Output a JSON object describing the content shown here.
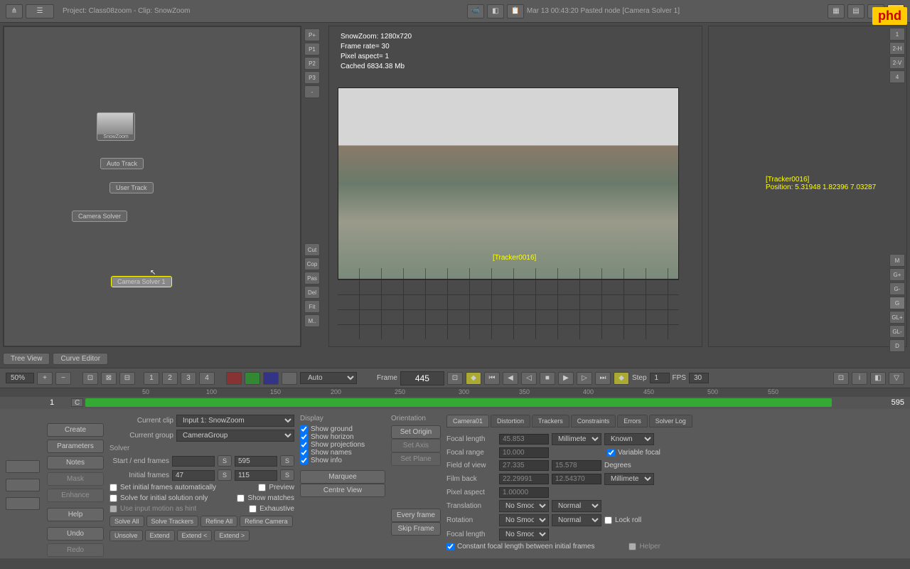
{
  "toolbar": {
    "project_info": "Project: Class08zoom - Clip: SnowZoom",
    "status": "Mar 13 00:43:20 Pasted node [Camera Solver 1]"
  },
  "logo": "phd",
  "nodes": {
    "source": "SnowZoom",
    "autotrack": "Auto Track",
    "usertrack": "User Track",
    "camsolver": "Camera Solver",
    "camsolver1": "Camera Solver 1"
  },
  "side_buttons_left": [
    "P+",
    "P1",
    "P2",
    "P3",
    "-",
    "Cut",
    "Cop",
    "Pas",
    "Del",
    "Fit",
    "M.."
  ],
  "viewport": {
    "info1": "SnowZoom: 1280x720",
    "info2": "Frame rate= 30",
    "info3": "Pixel aspect= 1",
    "info4": "Cached 6834.38 Mb",
    "tracker_label": "[Tracker0016]",
    "tracker_pos": "Position: 5.31948 1.82396 7.03287"
  },
  "right_buttons": [
    "1",
    "2-H",
    "2-V",
    "4",
    "M",
    "G+",
    "G-",
    "G",
    "GL+",
    "GL-",
    "D"
  ],
  "tabs": {
    "tree": "Tree View",
    "curve": "Curve Editor"
  },
  "timeline": {
    "zoom": "50%",
    "pages": [
      "1",
      "2",
      "3",
      "4"
    ],
    "mode": "Auto",
    "frame_label": "Frame",
    "frame": "445",
    "step_label": "Step",
    "step": "1",
    "fps_label": "FPS",
    "fps": "30",
    "start": "1",
    "end": "595",
    "c_label": "C",
    "ticks": [
      "50",
      "100",
      "150",
      "200",
      "250",
      "300",
      "350",
      "400",
      "450",
      "500",
      "550"
    ]
  },
  "left_buttons": {
    "create": "Create",
    "parameters": "Parameters",
    "notes": "Notes",
    "mask": "Mask",
    "enhance": "Enhance",
    "help": "Help",
    "undo": "Undo",
    "redo": "Redo"
  },
  "solver": {
    "current_clip_label": "Current clip",
    "current_clip": "Input 1: SnowZoom",
    "current_group_label": "Current group",
    "current_group": "CameraGroup",
    "title": "Solver",
    "start_end_label": "Start / end frames",
    "start_end_s": "S",
    "end_frame": "595",
    "initial_label": "Initial frames",
    "initial1": "47",
    "initial2": "115",
    "check1": "Set initial frames automatically",
    "check2": "Solve for initial solution only",
    "check3": "Use input motion as hint",
    "check4": "Preview",
    "check5": "Show matches",
    "check6": "Exhaustive",
    "solve_all": "Solve All",
    "solve_trackers": "Solve Trackers",
    "refine_all": "Refine All",
    "refine_camera": "Refine Camera",
    "unsolve": "Unsolve",
    "extend": "Extend",
    "extend_left": "Extend <",
    "extend_right": "Extend >"
  },
  "display": {
    "title": "Display",
    "ground": "Show ground",
    "horizon": "Show horizon",
    "projections": "Show projections",
    "names": "Show names",
    "info": "Show info",
    "marquee": "Marquee",
    "centre": "Centre View"
  },
  "orientation": {
    "title": "Orientation",
    "set_origin": "Set Origin",
    "set_axis": "Set Axis",
    "set_plane": "Set Plane",
    "every_frame": "Every frame",
    "skip_frame": "Skip Frame"
  },
  "camera": {
    "tabs": [
      "Camera01",
      "Distortion",
      "Trackers",
      "Constraints",
      "Errors",
      "Solver Log"
    ],
    "focal_length_label": "Focal length",
    "focal_length": "45.853",
    "focal_unit": "Millimeters",
    "known": "Known",
    "focal_range_label": "Focal range",
    "focal_range": "10.000",
    "variable_focal": "Variable focal",
    "fov_label": "Field of view",
    "fov1": "27.335",
    "fov2": "15.578",
    "degrees": "Degrees",
    "film_back_label": "Film back",
    "fb1": "22.29991",
    "fb2": "12.54370",
    "fb_unit": "Millimeters",
    "pixel_aspect_label": "Pixel aspect",
    "pixel_aspect": "1.00000",
    "translation_label": "Translation",
    "no_smooth": "No Smooth",
    "normal": "Normal",
    "rotation_label": "Rotation",
    "lock_roll": "Lock roll",
    "focal_length2_label": "Focal length",
    "constant": "Constant focal length between initial frames",
    "helper": "Helper"
  }
}
